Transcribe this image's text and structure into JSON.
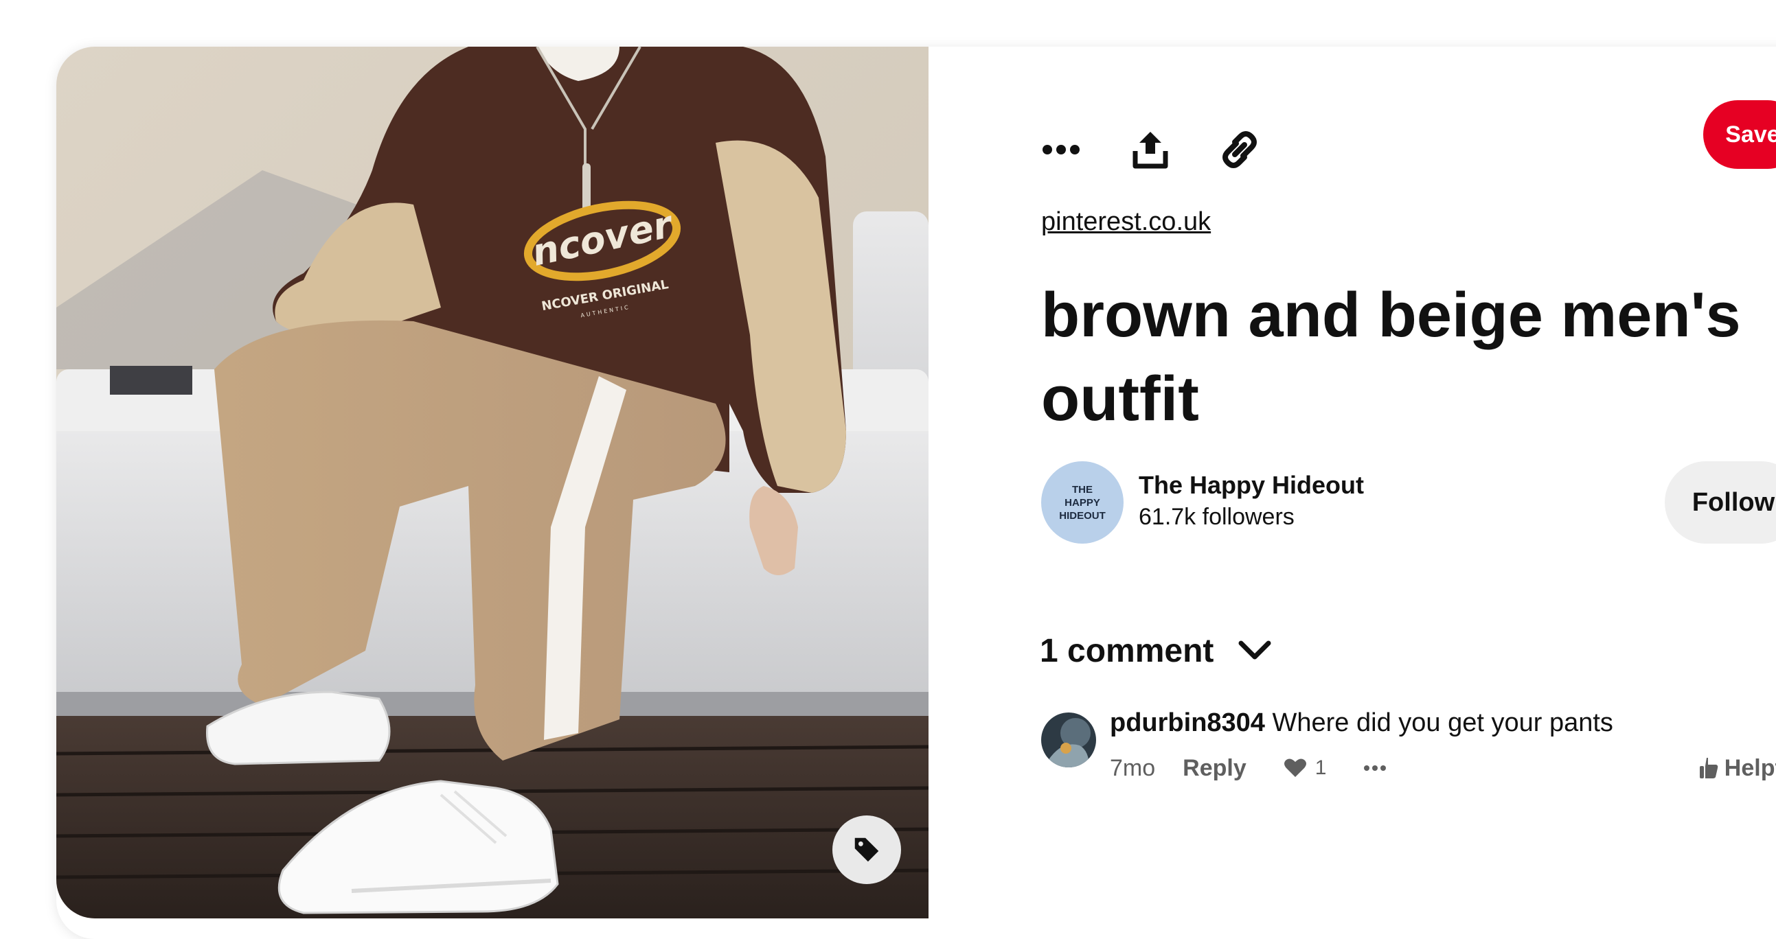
{
  "pin": {
    "image_alt": "Man sitting on a grey sofa wearing a brown and beige NCOVER sweatshirt, beige trousers with white side stripe and white sneakers",
    "image_print_brand": "ncover",
    "image_print_line1": "NCOVER ORIGINAL",
    "image_print_line2": "AUTHENTIC"
  },
  "toolbar": {
    "more_icon": "ellipsis-icon",
    "share_icon": "share-upload-icon",
    "link_icon": "link-icon",
    "save_label": "Save"
  },
  "source": {
    "label": "pinterest.co.uk"
  },
  "title": "brown and beige men's outfit",
  "owner": {
    "avatar_line1": "THE",
    "avatar_line2": "HAPPY",
    "avatar_line3": "HIDEOUT",
    "name": "The Happy Hideout",
    "followers": "61.7k followers",
    "follow_label": "Follow"
  },
  "comments": {
    "count_label": "1 comment",
    "items": [
      {
        "user": "pdurbin8304",
        "text": "Where did you get your pants",
        "age": "7mo",
        "reply_label": "Reply",
        "likes": "1",
        "helpful_label": "Helpful"
      }
    ]
  },
  "colors": {
    "save_red": "#e60023",
    "follow_bg": "#efefef",
    "avatar_bg": "#b9d0ea",
    "text": "#111111",
    "muted": "#5f5f5f"
  }
}
